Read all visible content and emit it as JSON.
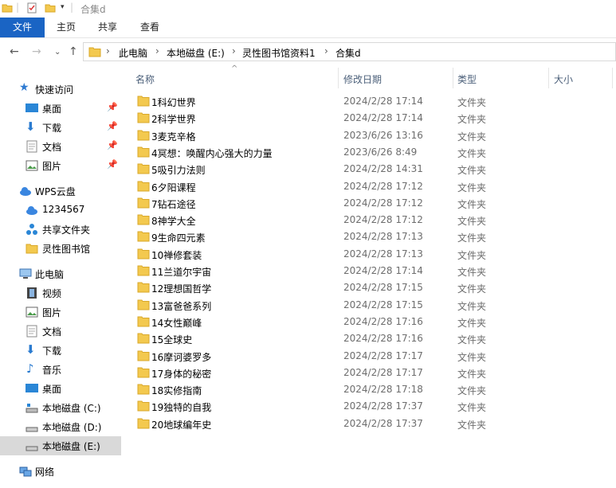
{
  "window": {
    "title": "合集d"
  },
  "ribbon": {
    "tabs": [
      "文件",
      "主页",
      "共享",
      "查看"
    ]
  },
  "address": {
    "crumbs": [
      "此电脑",
      "本地磁盘 (E:)",
      "灵性图书馆资料1",
      "合集d"
    ]
  },
  "columns": {
    "name": "名称",
    "date": "修改日期",
    "type": "类型",
    "size": "大小"
  },
  "sidebar": {
    "quick_access": "快速访问",
    "quick_items": [
      "桌面",
      "下载",
      "文档",
      "图片"
    ],
    "wps": "WPS云盘",
    "wps_items": [
      "1234567",
      "共享文件夹",
      "灵性图书馆"
    ],
    "this_pc": "此电脑",
    "pc_items": [
      "视频",
      "图片",
      "文档",
      "下载",
      "音乐",
      "桌面",
      "本地磁盘 (C:)",
      "本地磁盘 (D:)",
      "本地磁盘 (E:)"
    ],
    "network": "网络"
  },
  "files": [
    {
      "name": "1科幻世界",
      "date": "2024/2/28 17:14",
      "type": "文件夹"
    },
    {
      "name": "2科学世界",
      "date": "2024/2/28 17:14",
      "type": "文件夹"
    },
    {
      "name": "3麦克辛格",
      "date": "2023/6/26 13:16",
      "type": "文件夹"
    },
    {
      "name": "4冥想：唤醒内心强大的力量",
      "date": "2023/6/26 8:49",
      "type": "文件夹"
    },
    {
      "name": "5吸引力法则",
      "date": "2024/2/28 14:31",
      "type": "文件夹"
    },
    {
      "name": "6夕阳课程",
      "date": "2024/2/28 17:12",
      "type": "文件夹"
    },
    {
      "name": "7钻石途径",
      "date": "2024/2/28 17:12",
      "type": "文件夹"
    },
    {
      "name": "8神学大全",
      "date": "2024/2/28 17:12",
      "type": "文件夹"
    },
    {
      "name": "9生命四元素",
      "date": "2024/2/28 17:13",
      "type": "文件夹"
    },
    {
      "name": "10禅修套装",
      "date": "2024/2/28 17:13",
      "type": "文件夹"
    },
    {
      "name": "11兰道尔宇宙",
      "date": "2024/2/28 17:14",
      "type": "文件夹"
    },
    {
      "name": "12理想国哲学",
      "date": "2024/2/28 17:15",
      "type": "文件夹"
    },
    {
      "name": "13富爸爸系列",
      "date": "2024/2/28 17:15",
      "type": "文件夹"
    },
    {
      "name": "14女性巅峰",
      "date": "2024/2/28 17:16",
      "type": "文件夹"
    },
    {
      "name": "15全球史",
      "date": "2024/2/28 17:16",
      "type": "文件夹"
    },
    {
      "name": "16摩诃婆罗多",
      "date": "2024/2/28 17:17",
      "type": "文件夹"
    },
    {
      "name": "17身体的秘密",
      "date": "2024/2/28 17:17",
      "type": "文件夹"
    },
    {
      "name": "18实修指南",
      "date": "2024/2/28 17:18",
      "type": "文件夹"
    },
    {
      "name": "19独特的自我",
      "date": "2024/2/28 17:37",
      "type": "文件夹"
    },
    {
      "name": "20地球编年史",
      "date": "2024/2/28 17:37",
      "type": "文件夹"
    }
  ]
}
